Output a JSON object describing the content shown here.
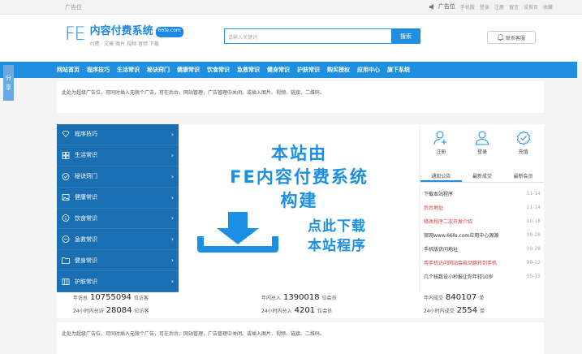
{
  "topbar": {
    "ad_slot": "广告位",
    "ad_label": "广告位",
    "links": [
      "手机版",
      "登录",
      "注册",
      "留言",
      "设首页",
      "收藏"
    ]
  },
  "header": {
    "logo_mark": "FE",
    "logo_title": "内容付费系统",
    "logo_badge": "66fe.com",
    "logo_sub": "付费 · 文章 图片 视频 音频 下载",
    "search_placeholder": "请输入关键词",
    "search_button": "搜索",
    "service_button": "联系客服"
  },
  "nav": {
    "items": [
      "网站首页",
      "程序技巧",
      "生活常识",
      "秘诀窍门",
      "健康常识",
      "饮食常识",
      "急救常识",
      "健身常识",
      "护肤常识",
      "购买授权",
      "应用中心",
      "旗下系统"
    ]
  },
  "sidetab": {
    "l1": "分",
    "l2": "享"
  },
  "ad_text_1": "此处为超级广告位，可同时插入无限个广告，可在后台，网站管理，广告管理中关闭。或插入图片、视频、链接、二维码。",
  "ad_text_2": "此处为超级广告位，可同时插入无限个广告，可在后台，网站管理，广告管理中关闭。或插入图片、视频、链接、二维码。",
  "menu": {
    "items": [
      {
        "label": "程序技巧",
        "icon": "diamond-icon"
      },
      {
        "label": "生活常识",
        "icon": "grid-icon"
      },
      {
        "label": "秘诀窍门",
        "icon": "check-circle-icon"
      },
      {
        "label": "健康常识",
        "icon": "image-icon"
      },
      {
        "label": "饮食常识",
        "icon": "info-icon"
      },
      {
        "label": "急救常识",
        "icon": "minus-circle-icon"
      },
      {
        "label": "健身常识",
        "icon": "folder-icon"
      },
      {
        "label": "护肤常识",
        "icon": "columns-icon"
      }
    ]
  },
  "banner": {
    "line1": "本站由",
    "line2": "FE内容付费系统",
    "line3": "构建",
    "download_line1": "点此下载",
    "download_line2": "本站程序"
  },
  "userbox": {
    "register": "注册",
    "login": "登录",
    "recharge": "充值",
    "tabs": [
      "通知公告",
      "最新成交",
      "最新会员"
    ],
    "notices": [
      {
        "title": "下载本站程序",
        "date": "11-14",
        "red": false
      },
      {
        "title": "后台地址",
        "date": "11-14",
        "red": true
      },
      {
        "title": "修改程序二次开发介绍",
        "date": "10-18",
        "red": true
      },
      {
        "title": "官网www.66fe.com应用中心源源",
        "date": "09-28",
        "red": false
      },
      {
        "title": "手机版访问地址",
        "date": "09-28",
        "red": false
      },
      {
        "title": "用手机访问网站会自动跳转到手机",
        "date": "09-23",
        "red": true
      },
      {
        "title": "几个核数设小秒报让你年轻10岁",
        "date": "05-13",
        "red": false
      }
    ]
  },
  "stats": {
    "s1_label": "年访总",
    "s1_value": "10755094",
    "s1_unit": "位访客",
    "s2_label": "年内总入",
    "s2_value": "1390018",
    "s2_unit": "位会员",
    "s3_label": "年内成交",
    "s3_value": "840107",
    "s3_unit": "单",
    "s4_label": "24小时内总访",
    "s4_value": "28084",
    "s4_unit": "位访客",
    "s5_label": "24小时内总入",
    "s5_value": "4201",
    "s5_unit": "位会员",
    "s6_label": "24小时内成交",
    "s6_value": "2554",
    "s6_unit": "单"
  },
  "colors": {
    "brand": "#1f8fe0",
    "menu_bg": "#1a6fb3",
    "red": "#d33333"
  }
}
